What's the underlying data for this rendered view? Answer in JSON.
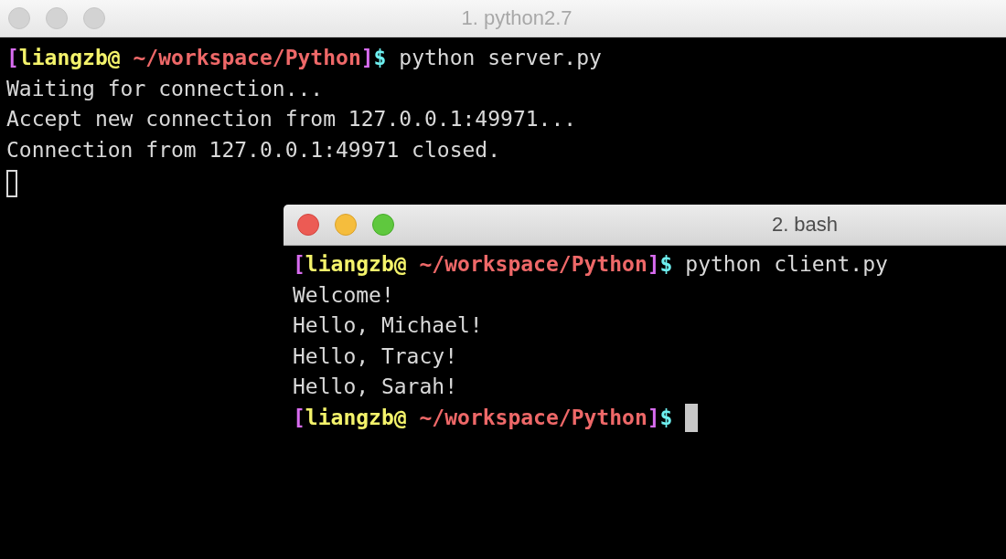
{
  "windows": [
    {
      "title": "1. python2.7",
      "active": false,
      "lines": [
        {
          "kind": "prompt",
          "open": "[",
          "user": "liangzb@",
          "path": "~/workspace/Python",
          "close": "]",
          "sign": "$",
          "command": "python server.py"
        },
        {
          "kind": "output",
          "text": "Waiting for connection..."
        },
        {
          "kind": "output",
          "text": "Accept new connection from 127.0.0.1:49971..."
        },
        {
          "kind": "output",
          "text": "Connection from 127.0.0.1:49971 closed."
        },
        {
          "kind": "cursor"
        }
      ]
    },
    {
      "title": "2. bash",
      "active": true,
      "lines": [
        {
          "kind": "prompt",
          "open": "[",
          "user": "liangzb@",
          "path": "~/workspace/Python",
          "close": "]",
          "sign": "$",
          "command": "python client.py"
        },
        {
          "kind": "output",
          "text": "Welcome!"
        },
        {
          "kind": "output",
          "text": "Hello, Michael!"
        },
        {
          "kind": "output",
          "text": "Hello, Tracy!"
        },
        {
          "kind": "output",
          "text": "Hello, Sarah!"
        },
        {
          "kind": "prompt",
          "open": "[",
          "user": "liangzb@",
          "path": "~/workspace/Python",
          "close": "]",
          "sign": "$"
        },
        {
          "kind": "cursor"
        }
      ]
    }
  ]
}
